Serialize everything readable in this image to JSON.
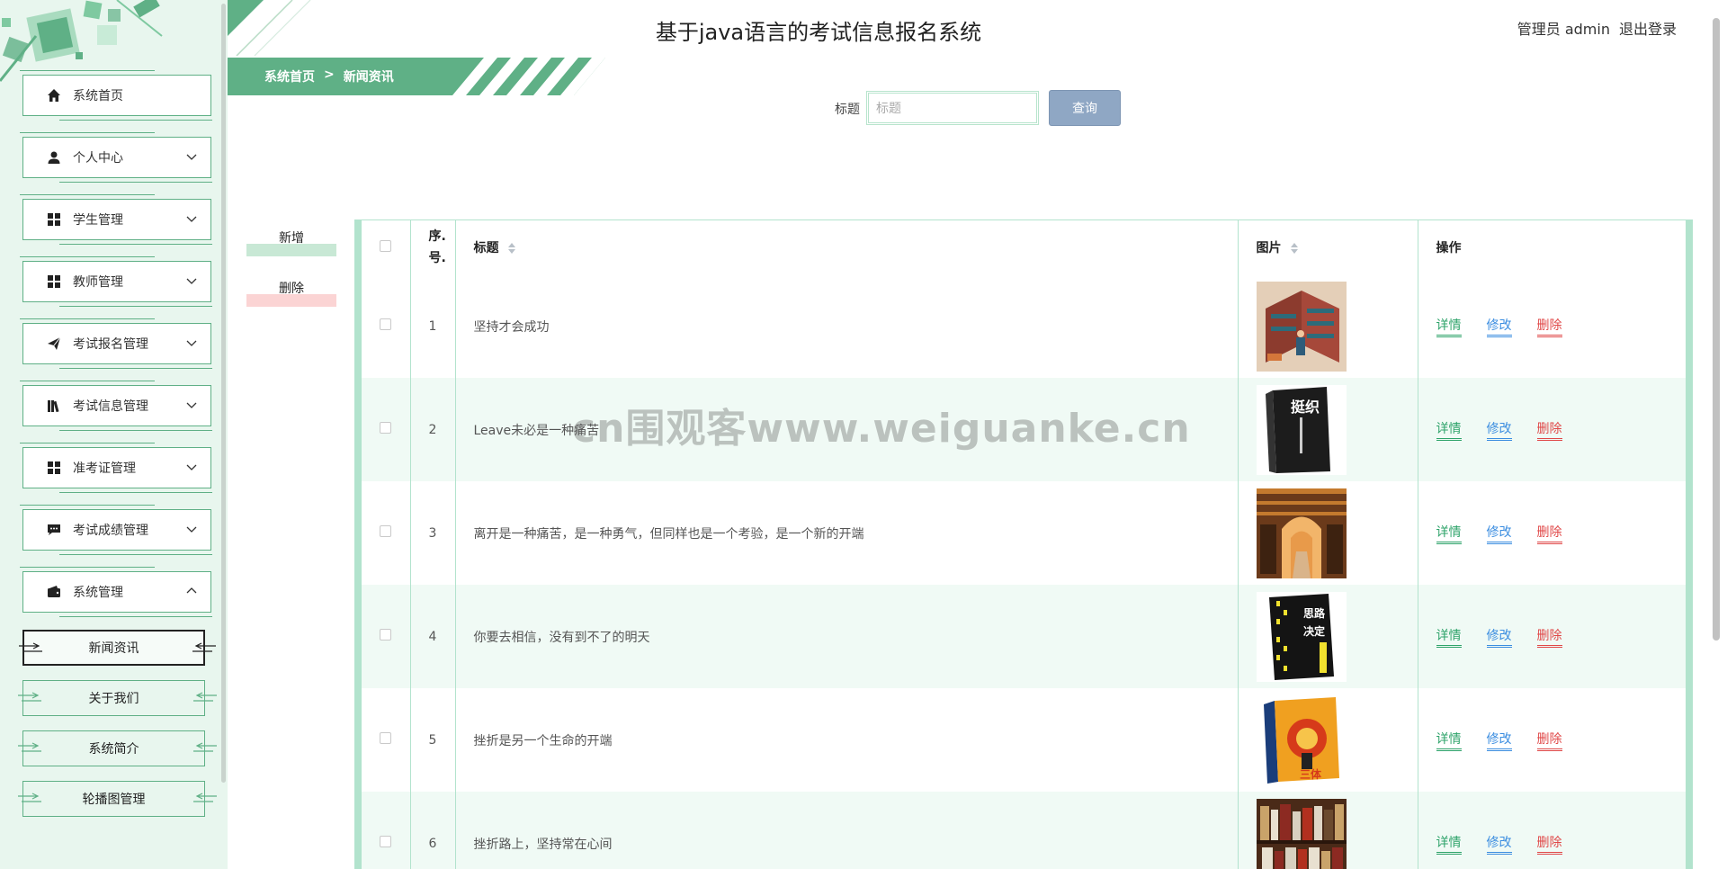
{
  "app": {
    "title": "基于java语言的考试信息报名系统"
  },
  "user": {
    "role_name": "管理员 admin",
    "logout": "退出登录"
  },
  "breadcrumb": {
    "home": "系统首页",
    "sep": ">",
    "current": "新闻资讯"
  },
  "sidebar": {
    "items": [
      {
        "label": "系统首页",
        "icon": "home-icon"
      },
      {
        "label": "个人中心",
        "icon": "user-icon"
      },
      {
        "label": "学生管理",
        "icon": "grid-icon"
      },
      {
        "label": "教师管理",
        "icon": "grid-icon"
      },
      {
        "label": "考试报名管理",
        "icon": "send-icon"
      },
      {
        "label": "考试信息管理",
        "icon": "library-icon"
      },
      {
        "label": "准考证管理",
        "icon": "grid-icon"
      },
      {
        "label": "考试成绩管理",
        "icon": "comment-icon"
      },
      {
        "label": "系统管理",
        "icon": "wallet-icon"
      }
    ],
    "sub_items": [
      {
        "label": "新闻资讯",
        "active": true
      },
      {
        "label": "关于我们",
        "active": false
      },
      {
        "label": "系统简介",
        "active": false
      },
      {
        "label": "轮播图管理",
        "active": false
      }
    ]
  },
  "search": {
    "label": "标题",
    "placeholder": "标题",
    "button": "查询"
  },
  "actions": {
    "add": "新增",
    "delete": "删除"
  },
  "table": {
    "headers": {
      "index": "序.号.",
      "title": "标题",
      "image": "图片",
      "ops": "操作"
    },
    "op_labels": {
      "detail": "详情",
      "edit": "修改",
      "delete": "删除"
    },
    "rows": [
      {
        "no": "1",
        "title": "坚持才会成功",
        "image": "isometric-library"
      },
      {
        "no": "2",
        "title": "Leave未必是一种痛苦",
        "image": "black-book-cover"
      },
      {
        "no": "3",
        "title": "离开是一种痛苦，是一种勇气，但同样也是一个考验，是一个新的开端",
        "image": "library-arch"
      },
      {
        "no": "4",
        "title": "你要去相信，没有到不了的明天",
        "image": "yellow-black-book"
      },
      {
        "no": "5",
        "title": "挫折是另一个生命的开端",
        "image": "santi-book"
      },
      {
        "no": "6",
        "title": "挫折路上，坚持常在心间",
        "image": "bookshelf"
      }
    ]
  },
  "watermark": "cn围观客www.weiguanke.cn",
  "colors": {
    "accent": "#5fb086",
    "table_border": "#b2e3cd",
    "row_alt": "#f0faf5",
    "search_button": "#8fa7c4"
  }
}
